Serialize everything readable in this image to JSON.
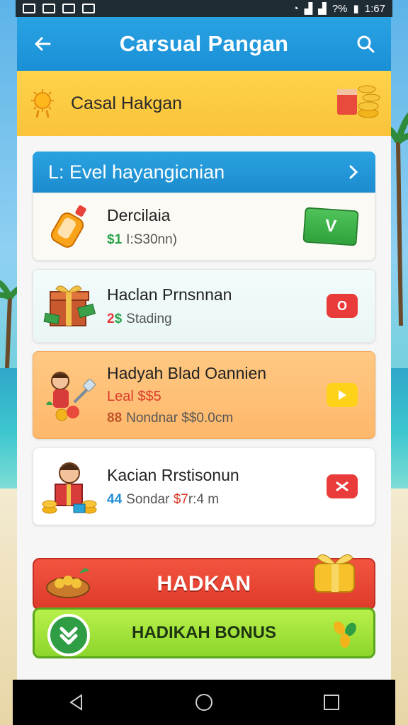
{
  "status_bar": {
    "battery": "?%",
    "time": "1:67"
  },
  "app_bar": {
    "title": "Carsual Pangan"
  },
  "banner": {
    "title": "Casal Hakgan"
  },
  "section": {
    "title": "L: Evel hayangicnian"
  },
  "cards": [
    {
      "name": "Dercilaia",
      "sub_num": "$1",
      "sub_text": "I:S30nn)",
      "num_color": "#2aa34a",
      "action_label": "V"
    },
    {
      "name": "Haclan Prnsnnan",
      "sub_num": "2",
      "sub_num2": "$",
      "sub_text": "Stading",
      "num_color": "#e43a3a",
      "action_label": "O"
    },
    {
      "name": "Hadyah Blad Oannien",
      "line2": "Leal $$5",
      "sub_num": "88",
      "sub_text": "Nondnar $$0.0cm",
      "num_color": "#c3542b"
    },
    {
      "name": "Kacian Rrstisonun",
      "sub_num": "44",
      "sub_text": "Sondar",
      "price": "$7",
      "tail": "r:4 m",
      "num_color": "#1f8fd6"
    }
  ],
  "bottom": {
    "red_label": "HADKAN",
    "green_label": "HADIKAH BONUS"
  },
  "colors": {
    "primary": "#1a8fd6",
    "banner": "#f9c33a",
    "accent_red": "#de3a2b",
    "accent_green": "#8cd62c"
  }
}
